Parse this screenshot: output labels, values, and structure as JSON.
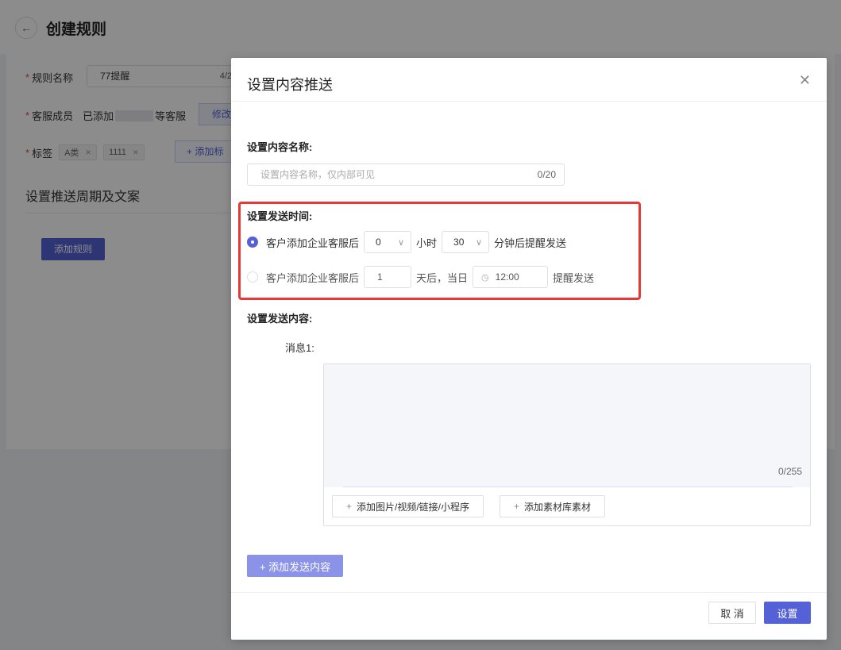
{
  "page": {
    "title": "创建规则",
    "back_icon": "arrow-left-icon",
    "rule_name_label": "规则名称",
    "rule_name_value": "77提醒",
    "rule_name_count": "4/2",
    "service_label": "客服成员",
    "service_prefix": "已添加",
    "service_suffix": "等客服",
    "edit_label": "修改",
    "tag_label": "标签",
    "tags": [
      "A类",
      "1111"
    ],
    "add_tag_label": "+ 添加标",
    "section_title": "设置推送周期及文案",
    "add_rule_label": "添加规则"
  },
  "modal": {
    "title": "设置内容推送",
    "name_label": "设置内容名称:",
    "name_placeholder": "设置内容名称，仅内部可见",
    "name_count": "0/20",
    "time_label": "设置发送时间:",
    "option1": {
      "prefix": "客户添加企业客服后",
      "hours": "0",
      "hours_unit": "小时",
      "minutes": "30",
      "suffix": "分钟后提醒发送",
      "selected": true
    },
    "option2": {
      "prefix": "客户添加企业客服后",
      "days": "1",
      "days_unit": "天后，当日",
      "time": "12:00",
      "suffix": "提醒发送",
      "selected": false
    },
    "content_label": "设置发送内容:",
    "message_label": "消息1:",
    "message_count": "0/255",
    "add_media_label": "添加图片/视频/链接/小程序",
    "add_material_label": "添加素材库素材",
    "add_content_label": "+ 添加发送内容",
    "cancel_label": "取 消",
    "ok_label": "设置"
  },
  "colors": {
    "accent": "#5561d6",
    "highlight": "#e53935"
  }
}
